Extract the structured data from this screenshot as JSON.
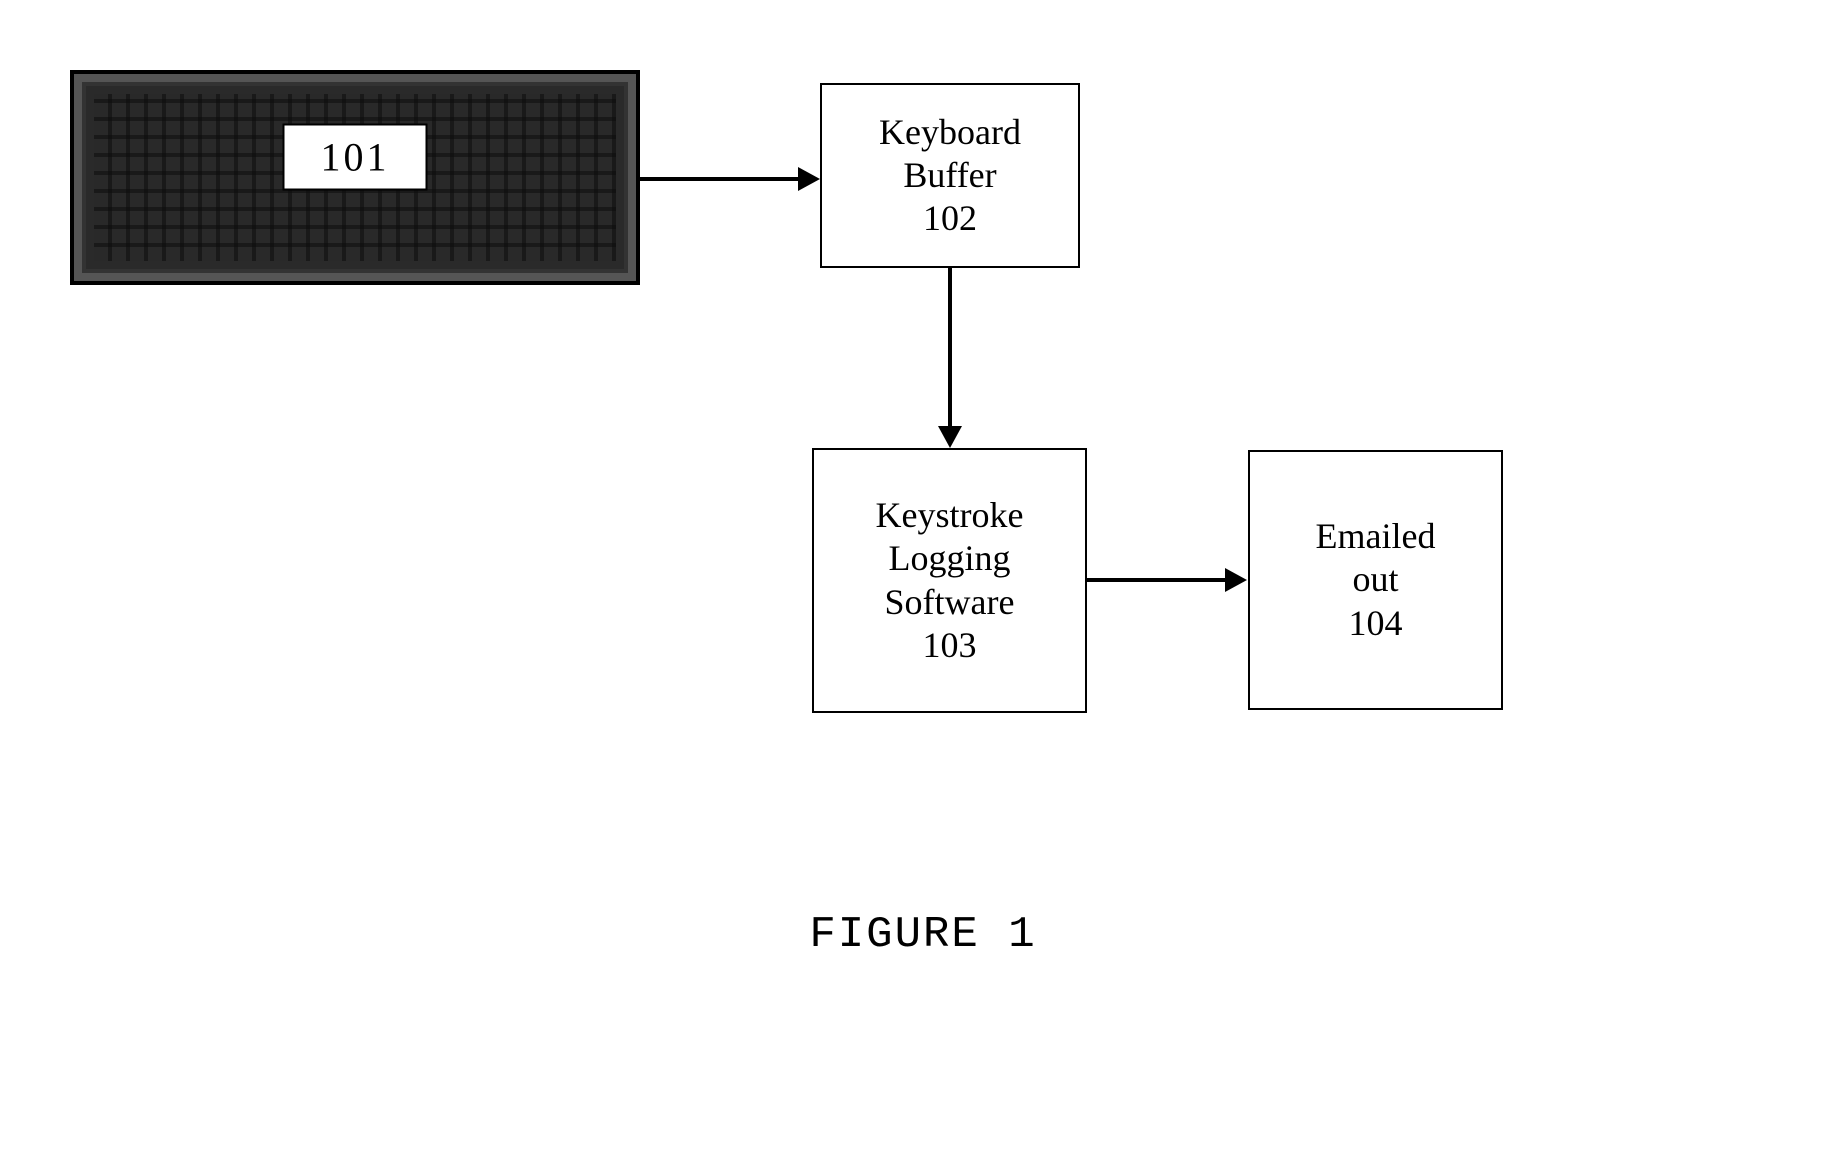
{
  "nodes": {
    "keyboard": {
      "label": "101"
    },
    "buffer": {
      "line1": "Keyboard",
      "line2": "Buffer",
      "ref": "102"
    },
    "logger": {
      "line1": "Keystroke",
      "line2": "Logging",
      "line3": "Software",
      "ref": "103"
    },
    "email": {
      "line1": "Emailed",
      "line2": "out",
      "ref": "104"
    }
  },
  "caption": "FIGURE 1"
}
